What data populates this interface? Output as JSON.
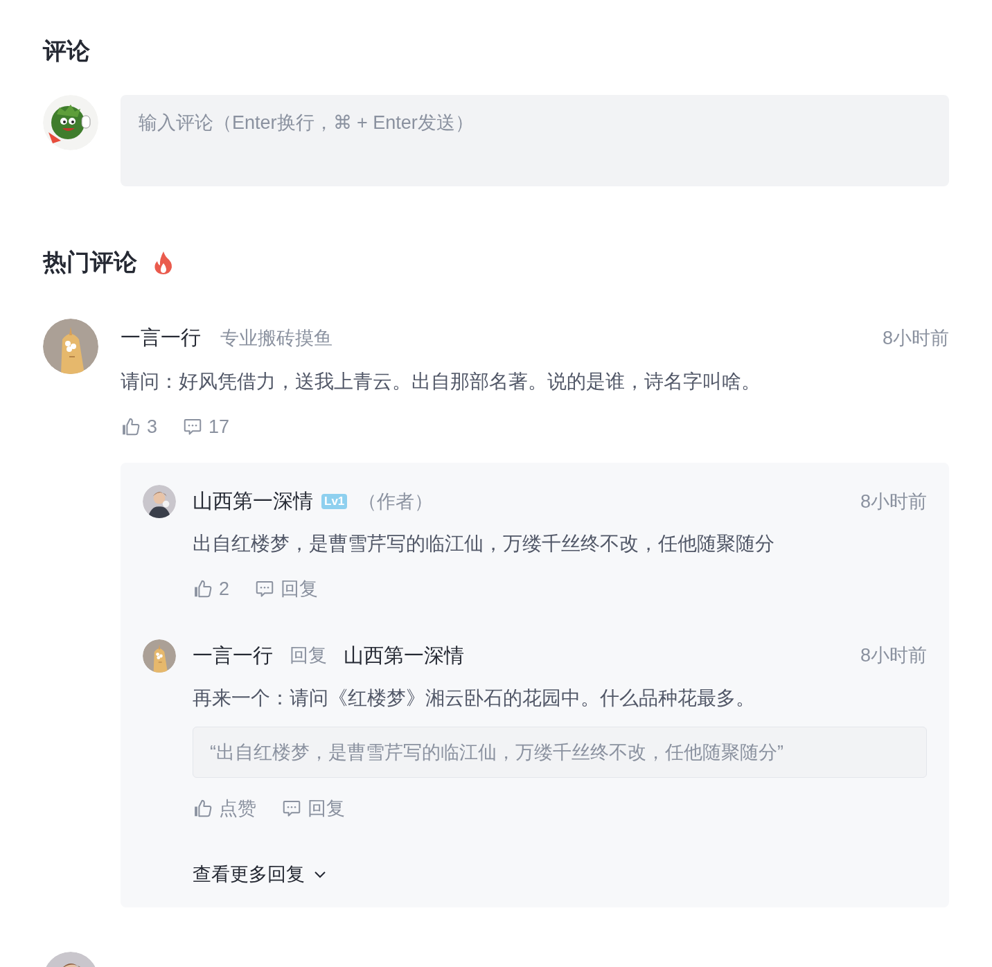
{
  "page_title": "评论",
  "composer": {
    "placeholder": "输入评论（Enter换行，⌘ + Enter发送）"
  },
  "hot_title": "热门评论",
  "comments": [
    {
      "author": "一言一行",
      "tagline": "专业搬砖摸鱼",
      "time": "8小时前",
      "content": "请问：好风凭借力，送我上青云。出自那部名著。说的是谁，诗名字叫啥。",
      "likes": "3",
      "reply_count": "17",
      "replies": [
        {
          "author": "山西第一深情",
          "level_badge": "Lv1",
          "role": "（作者）",
          "time": "8小时前",
          "content": "出自红楼梦，是曹雪芹写的临江仙，万缕千丝终不改，任他随聚随分",
          "like_label": "2",
          "reply_label": "回复"
        },
        {
          "author": "一言一行",
          "reply_word": "回复",
          "reply_to": "山西第一深情",
          "time": "8小时前",
          "content": "再来一个：请问《红楼梦》湘云卧石的花园中。什么品种花最多。",
          "quote": "“出自红楼梦，是曹雪芹写的临江仙，万缕千丝终不改，任他随聚随分”",
          "like_label": "点赞",
          "reply_label": "回复"
        }
      ],
      "more_replies": "查看更多回复"
    }
  ]
}
